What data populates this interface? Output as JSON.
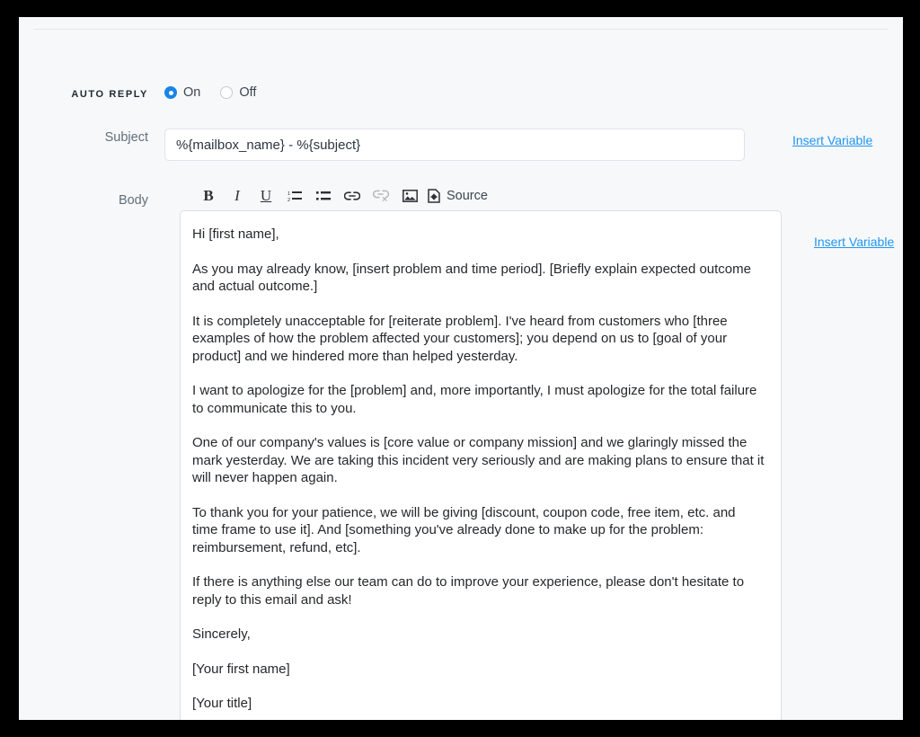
{
  "theme": {
    "accent_blue": "#1a85e8",
    "link_blue": "#2196f3",
    "panel_bg": "#f7f8f9",
    "frame": "#000000",
    "text": "#25282b",
    "label": "#606f7b"
  },
  "auto_reply": {
    "label": "AUTO REPLY",
    "options": [
      {
        "value": "on",
        "label": "On",
        "selected": true
      },
      {
        "value": "off",
        "label": "Off",
        "selected": false
      }
    ]
  },
  "subject": {
    "label": "Subject",
    "value": "%{mailbox_name} - %{subject}",
    "placeholder": "",
    "insert_variable_label": "Insert Variable"
  },
  "body": {
    "label": "Body",
    "insert_variable_label": "Insert Variable",
    "toolbar": [
      {
        "name": "bold-icon",
        "label": "B",
        "tooltip": "Bold",
        "disabled": false
      },
      {
        "name": "italic-icon",
        "label": "I",
        "tooltip": "Italic",
        "disabled": false
      },
      {
        "name": "underline-icon",
        "label": "U",
        "tooltip": "Underline",
        "disabled": false
      },
      {
        "name": "numbered-list-icon",
        "label": "",
        "tooltip": "Insert/Remove Numbered List",
        "disabled": false
      },
      {
        "name": "bulleted-list-icon",
        "label": "",
        "tooltip": "Insert/Remove Bulleted List",
        "disabled": false
      },
      {
        "name": "link-icon",
        "label": "",
        "tooltip": "Link",
        "disabled": false
      },
      {
        "name": "unlink-icon",
        "label": "",
        "tooltip": "Unlink",
        "disabled": true
      },
      {
        "name": "image-icon",
        "label": "",
        "tooltip": "Image",
        "disabled": false
      }
    ],
    "source_button_label": "Source",
    "paragraphs": [
      "Hi [first name],",
      "As you may already know, [insert problem and time period]. [Briefly explain expected outcome and actual outcome.]",
      "It is completely unacceptable for [reiterate problem]. I've heard from customers who [three examples of how the problem affected your customers]; you depend on us to [goal of your product] and we hindered more than helped yesterday.",
      "I want to apologize for the [problem] and, more importantly, I must apologize for the total failure to communicate this to you.",
      "One of our company's values is [core value or company mission] and we glaringly missed the mark yesterday. We are taking this incident very seriously and are making plans to ensure that it will never happen again.",
      "To thank you for your patience, we will be giving [discount, coupon code, free item, etc. and time frame to use it]. And [something you've already done to make up for the problem: reimbursement, refund, etc].",
      "If there is anything else our team can do to improve your experience, please don't hesitate to reply to this email and ask!",
      "Sincerely,",
      "[Your first name]",
      "[Your title]"
    ]
  }
}
